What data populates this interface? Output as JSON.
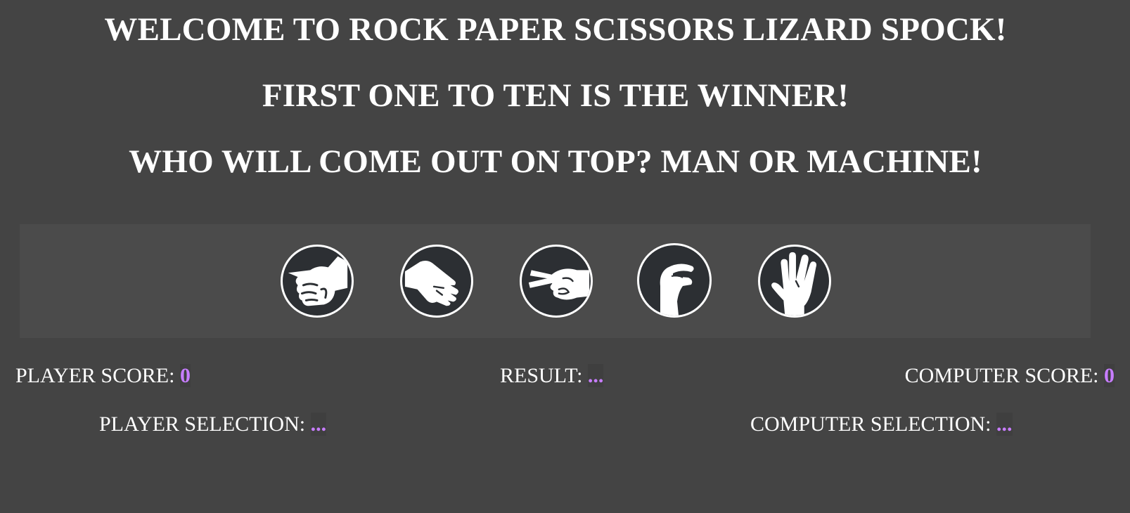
{
  "headings": {
    "welcome": "WELCOME TO ROCK PAPER SCISSORS LIZARD SPOCK!",
    "rule": "FIRST ONE TO TEN IS THE WINNER!",
    "question": "WHO WILL COME OUT ON TOP? MAN OR MACHINE!"
  },
  "choices": [
    {
      "name": "rock",
      "icon": "rock-hand-icon"
    },
    {
      "name": "paper",
      "icon": "paper-hand-icon"
    },
    {
      "name": "scissors",
      "icon": "scissors-hand-icon"
    },
    {
      "name": "lizard",
      "icon": "lizard-hand-icon"
    },
    {
      "name": "spock",
      "icon": "spock-hand-icon"
    }
  ],
  "scoreboard": {
    "player_score_label": "PLAYER SCORE: ",
    "player_score_value": "0",
    "result_label": "RESULT: ",
    "result_value": "...",
    "computer_score_label": "COMPUTER SCORE: ",
    "computer_score_value": "0",
    "player_selection_label": "PLAYER SELECTION: ",
    "player_selection_value": "...",
    "computer_selection_label": "COMPUTER SELECTION: ",
    "computer_selection_value": "..."
  },
  "colors": {
    "background": "#444444",
    "panel": "#4b4b4b",
    "accent": "#c77dff",
    "icon_bg": "#2c2f33"
  }
}
